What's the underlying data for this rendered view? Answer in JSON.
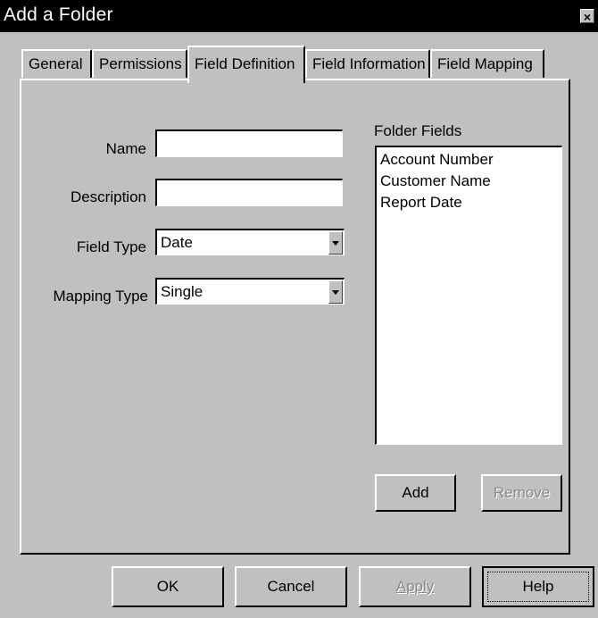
{
  "window": {
    "title": "Add a Folder"
  },
  "tabs": [
    {
      "label": "General"
    },
    {
      "label": "Permissions"
    },
    {
      "label": "Field Definition"
    },
    {
      "label": "Field Information"
    },
    {
      "label": "Field Mapping"
    }
  ],
  "form": {
    "name_label": "Name",
    "name_value": "",
    "description_label": "Description",
    "description_value": "",
    "field_type_label": "Field Type",
    "field_type_value": "Date",
    "mapping_type_label": "Mapping Type",
    "mapping_type_value": "Single"
  },
  "folder_fields": {
    "label": "Folder Fields",
    "items": [
      "Account Number",
      "Customer Name",
      "Report Date"
    ],
    "add_label": "Add",
    "remove_label": "Remove"
  },
  "footer": {
    "ok_label": "OK",
    "cancel_label": "Cancel",
    "apply_label": "Apply",
    "help_label": "Help"
  }
}
